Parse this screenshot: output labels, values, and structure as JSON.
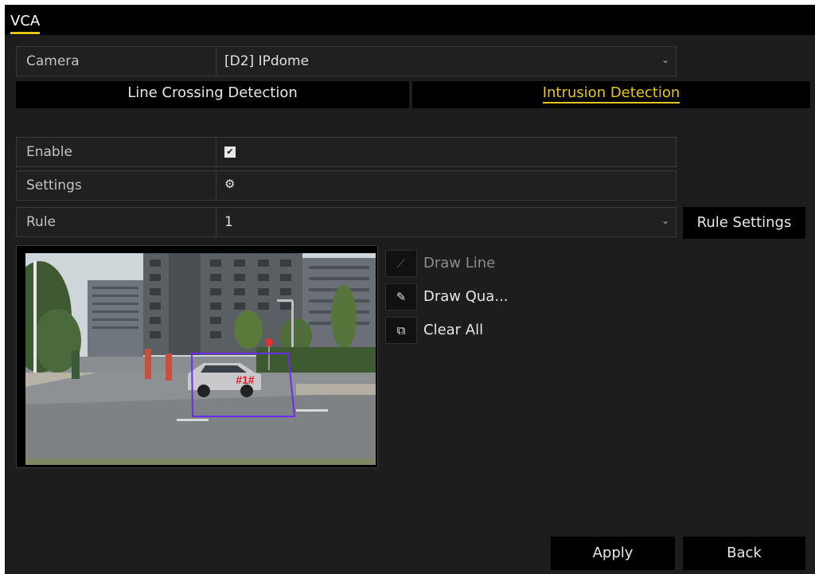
{
  "window": {
    "title": "VCA"
  },
  "camera": {
    "label": "Camera",
    "value": "[D2] IPdome"
  },
  "tabs": [
    {
      "label": "Line Crossing Detection",
      "active": false
    },
    {
      "label": "Intrusion Detection",
      "active": true
    }
  ],
  "enable": {
    "label": "Enable",
    "checked": true
  },
  "settings": {
    "label": "Settings"
  },
  "rule": {
    "label": "Rule",
    "value": "1",
    "settings_button": "Rule Settings"
  },
  "preview": {
    "region_label": "#1#"
  },
  "tools": [
    {
      "label": "Draw Line",
      "icon": "pencil-icon",
      "enabled": false
    },
    {
      "label": "Draw Qua...",
      "icon": "edit-icon",
      "enabled": true
    },
    {
      "label": "Clear All",
      "icon": "clear-icon",
      "enabled": true
    }
  ],
  "footer": {
    "apply": "Apply",
    "back": "Back"
  },
  "colors": {
    "accent": "#e5c41b",
    "region": "#6a2cf0"
  }
}
